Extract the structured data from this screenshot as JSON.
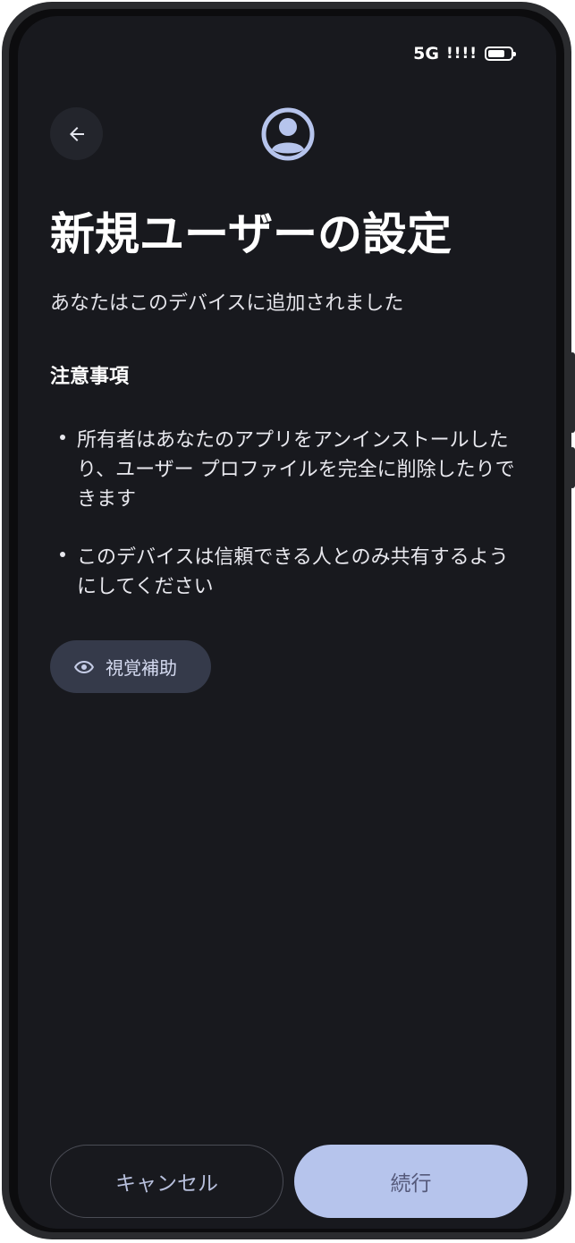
{
  "status_bar": {
    "network": "5G",
    "signal": "!!!!",
    "battery_level": 0.75
  },
  "header": {
    "back_icon": "arrow-left-icon",
    "avatar_icon": "account-circle-icon"
  },
  "content": {
    "title": "新規ユーザーの設定",
    "subtitle": "あなたはこのデバイスに追加されました",
    "section_title": "注意事項",
    "bullets": [
      "所有者はあなたのアプリをアンインストールしたり、ユーザー プロファイルを完全に削除したりできます",
      "このデバイスは信頼できる人とのみ共有するようにしてください"
    ]
  },
  "assist_button": {
    "icon": "eye-icon",
    "label": "視覚補助"
  },
  "footer": {
    "cancel_label": "キャンセル",
    "continue_label": "続行"
  },
  "colors": {
    "background": "#18191e",
    "accent": "#b6c4ec",
    "chip": "#353a4a"
  }
}
